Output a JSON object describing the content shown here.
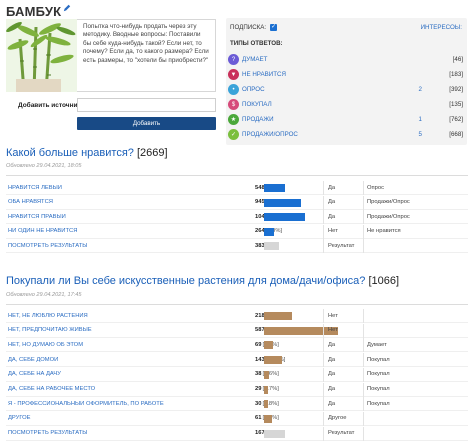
{
  "brand": {
    "name": "БАМБУК"
  },
  "description": "Попытка что-нибудь продать через эту методику. Вводные вопросы: Поставили бы себе куда-нибудь такой? Если нет, то почему? Если да, то какого размера? Если есть размеры, то \"хотели бы приобрести?\"",
  "add_source": {
    "label": "Добавить источник",
    "input_value": "",
    "button": "Добавить"
  },
  "panel": {
    "subscribe_label": "Подписка:",
    "interests_link": "Интересоы:",
    "types_title": "Типы ответов:",
    "types": [
      {
        "name": "Думает",
        "count": "",
        "bracket": "[46]",
        "icon": "thinking-face-icon",
        "color": "#6b5bd6"
      },
      {
        "name": "Не нравится",
        "count": "",
        "bracket": "[183]",
        "icon": "thumbs-down-icon",
        "color": "#c9305a"
      },
      {
        "name": "Опрос",
        "count": "2",
        "bracket": "[392]",
        "icon": "survey-icon",
        "color": "#3aa3d9"
      },
      {
        "name": "Покупал",
        "count": "",
        "bracket": "[135]",
        "icon": "purchased-icon",
        "color": "#d64a7a"
      },
      {
        "name": "Продажи",
        "count": "1",
        "bracket": "[762]",
        "icon": "sales-icon",
        "color": "#4aa83a"
      },
      {
        "name": "Продажи/Опрос",
        "count": "5",
        "bracket": "[668]",
        "icon": "sales-survey-icon",
        "color": "#7bbf3e"
      }
    ]
  },
  "questions": [
    {
      "title": "Какой больше нравится?",
      "count": "[2669]",
      "date": "Обновлено 29.04.2021, 18:05",
      "bar_color": "#1a6fd1",
      "answers": [
        {
          "label": "Нравится левый",
          "num": "548",
          "pct": "[20.5%]",
          "share": 0.205,
          "t1": "Да",
          "t2": "Опрос"
        },
        {
          "label": "Оба нравятся",
          "num": "945",
          "pct": "[35.4%]",
          "share": 0.354,
          "t1": "Да",
          "t2": "Продажи/Опрос"
        },
        {
          "label": "Нравится правый",
          "num": "1041",
          "pct": "[39%]",
          "share": 0.39,
          "t1": "Да",
          "t2": "Продажи/Опрос"
        },
        {
          "label": "Ни один не нравится",
          "num": "264",
          "pct": "[9.9%]",
          "share": 0.099,
          "t1": "Нет",
          "t2": "Не нравится"
        },
        {
          "label": "Посмотреть результаты",
          "num": "383",
          "pct": "",
          "share": 0.143,
          "t1": "Результат",
          "t2": "",
          "grey": true
        }
      ]
    },
    {
      "title": "Покупали ли Вы себе искусственные растения для дома/дачи/офиса?",
      "count": "[1066]",
      "date": "Обновлено 29.04.2021, 17:45",
      "bar_color": "#b58a5d",
      "answers": [
        {
          "label": "Нет, не люблю растения",
          "num": "218",
          "pct": "[20.5%]",
          "share": 0.205,
          "t1": "Нет",
          "t2": ""
        },
        {
          "label": "Нет, предпочитаю живые",
          "num": "587",
          "pct": "[55.1%]",
          "share": 0.551,
          "t1": "Нет",
          "t2": ""
        },
        {
          "label": "Нет, но думаю об этом",
          "num": "69",
          "pct": "[6.5%]",
          "share": 0.065,
          "t1": "Да",
          "t2": "Думает"
        },
        {
          "label": "Да, себе домой",
          "num": "143",
          "pct": "[13.4%]",
          "share": 0.134,
          "t1": "Да",
          "t2": "Покупал"
        },
        {
          "label": "Да, себе на дачу",
          "num": "38",
          "pct": "[3.6%]",
          "share": 0.036,
          "t1": "Да",
          "t2": "Покупал"
        },
        {
          "label": "Да, себе на рабочее место",
          "num": "29",
          "pct": "[2.7%]",
          "share": 0.027,
          "t1": "Да",
          "t2": "Покупал"
        },
        {
          "label": "Я - профессиональный оформитель, по работе",
          "num": "30",
          "pct": "[2.8%]",
          "share": 0.028,
          "t1": "Да",
          "t2": "Покупал"
        },
        {
          "label": "Другое",
          "num": "61",
          "pct": "[5.7%]",
          "share": 0.057,
          "t1": "Другое",
          "t2": ""
        },
        {
          "label": "Посмотреть результаты",
          "num": "167",
          "pct": "",
          "share": 0.157,
          "t1": "Результат",
          "t2": "",
          "grey": true
        }
      ]
    }
  ]
}
